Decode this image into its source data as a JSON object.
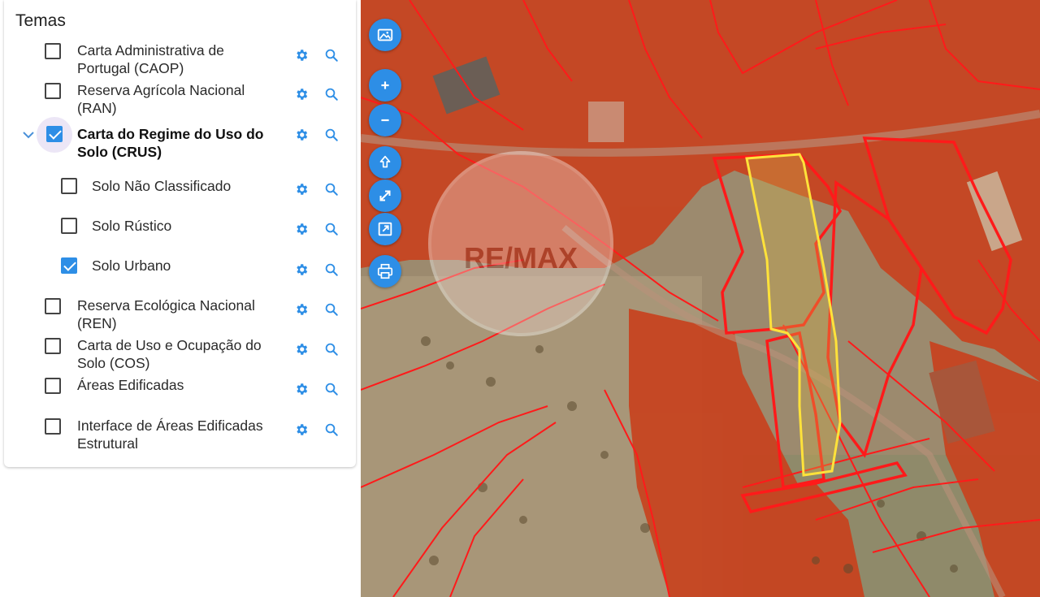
{
  "panel": {
    "title": "Temas",
    "layers": [
      {
        "label": "Carta Administrativa de Portugal (CAOP)",
        "checked": false
      },
      {
        "label": "Reserva Agrícola Nacional (RAN)",
        "checked": false
      },
      {
        "label": "Carta do Regime do Uso do Solo (CRUS)",
        "checked": true,
        "expanded": true,
        "children": [
          {
            "label": "Solo Não Classificado",
            "checked": false
          },
          {
            "label": "Solo Rústico",
            "checked": false
          },
          {
            "label": "Solo Urbano",
            "checked": true
          }
        ]
      },
      {
        "label": "Reserva Ecológica Nacional (REN)",
        "checked": false
      },
      {
        "label": "Carta de Uso e Ocupação do Solo (COS)",
        "checked": false
      },
      {
        "label": "Áreas Edificadas",
        "checked": false
      },
      {
        "label": "Interface de Áreas Edificadas Estrutural",
        "checked": false
      }
    ],
    "row_icons": [
      "gear-icon",
      "search-icon"
    ]
  },
  "map": {
    "watermark": "RE/MAX",
    "controls": [
      "image-icon",
      "zoom-in-icon",
      "zoom-out-icon",
      "north-arrow-icon",
      "fullscreen-icon",
      "extent-icon",
      "print-icon"
    ],
    "colors": {
      "zone_fill": "#c8421e",
      "zone_border": "#ff1a1a",
      "selected_parcel": "#ffe23a",
      "button": "#2d8ee6"
    }
  }
}
